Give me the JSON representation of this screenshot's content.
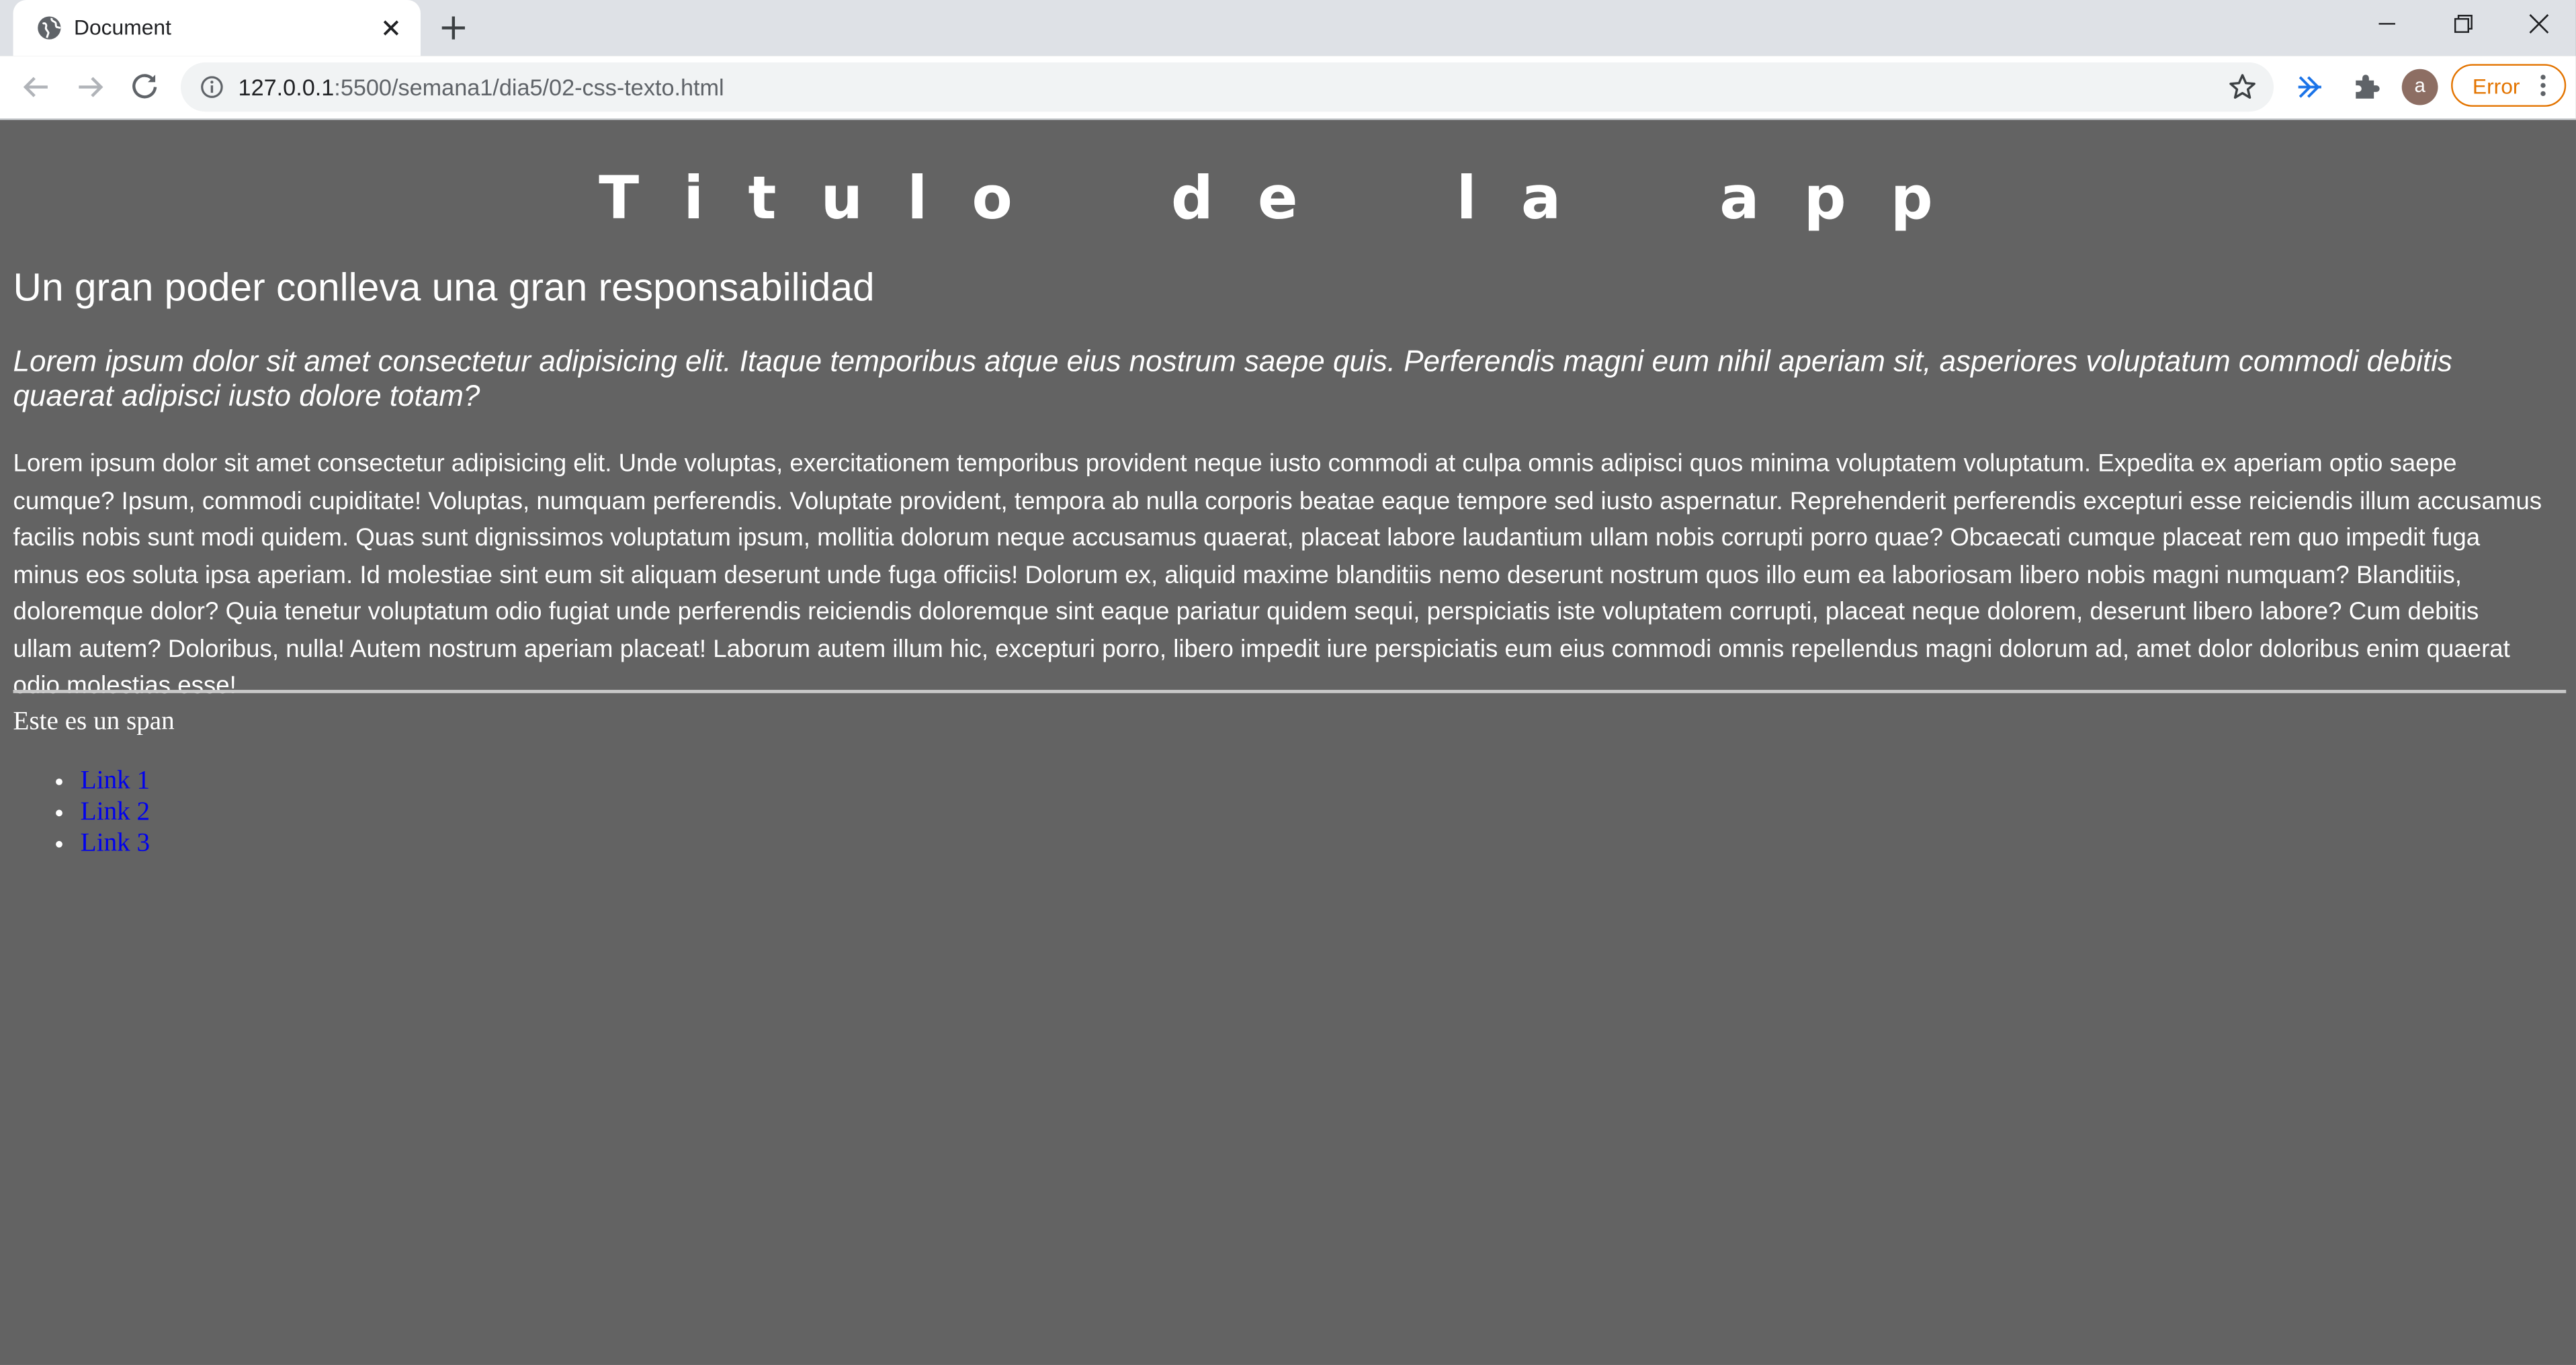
{
  "browser": {
    "tab_title": "Document",
    "url_host": "127.0.0.1",
    "url_path": ":5500/semana1/dia5/02-css-texto.html",
    "profile_initial": "a",
    "error_label": "Error",
    "icons": [
      "globe-icon",
      "close-icon",
      "plus-icon",
      "minimize-icon",
      "restore-icon",
      "window-close-icon",
      "back-icon",
      "forward-icon",
      "reload-icon",
      "info-icon",
      "star-icon",
      "cast-icon",
      "puzzle-icon",
      "more-icon"
    ]
  },
  "page": {
    "app_title": "Titulo de la app",
    "subtitle": "Un gran poder conlleva una gran responsabilidad",
    "lead": "Lorem ipsum dolor sit amet consectetur adipisicing elit. Itaque temporibus atque eius nostrum saepe quis. Perferendis magni eum nihil aperiam sit, asperiores voluptatum commodi debitis quaerat adipisci iusto dolore totam?",
    "body": "Lorem ipsum dolor sit amet consectetur adipisicing elit. Unde voluptas, exercitationem temporibus provident neque iusto commodi at culpa omnis adipisci quos minima voluptatem voluptatum. Expedita ex aperiam optio saepe cumque? Ipsum, commodi cupiditate! Voluptas, numquam perferendis. Voluptate provident, tempora ab nulla corporis beatae eaque tempore sed iusto aspernatur. Reprehenderit perferendis excepturi esse reiciendis illum accusamus facilis nobis sunt modi quidem. Quas sunt dignissimos voluptatum ipsum, mollitia dolorum neque accusamus quaerat, placeat labore laudantium ullam nobis corrupti porro quae? Obcaecati cumque placeat rem quo impedit fuga minus eos soluta ipsa aperiam. Id molestiae sint eum sit aliquam deserunt unde fuga officiis! Dolorum ex, aliquid maxime blanditiis nemo deserunt nostrum quos illo eum ea laboriosam libero nobis magni numquam? Blanditiis, doloremque dolor? Quia tenetur voluptatum odio fugiat unde perferendis reiciendis doloremque sint eaque pariatur quidem sequi, perspiciatis iste voluptatem corrupti, placeat neque dolorem, deserunt libero labore? Cum debitis ullam autem? Doloribus, nulla! Autem nostrum aperiam placeat! Laborum autem illum hic, excepturi porro, libero impedit iure perspiciatis eum eius commodi omnis repellendus magni dolorum ad, amet dolor doloribus enim quaerat odio molestias esse!",
    "span_text": "Este es un span",
    "links": [
      "Link 1",
      "Link 2",
      "Link 3"
    ]
  },
  "colors": {
    "page_background": "#636363",
    "link": "#0000ee",
    "error_accent": "#e37400"
  }
}
